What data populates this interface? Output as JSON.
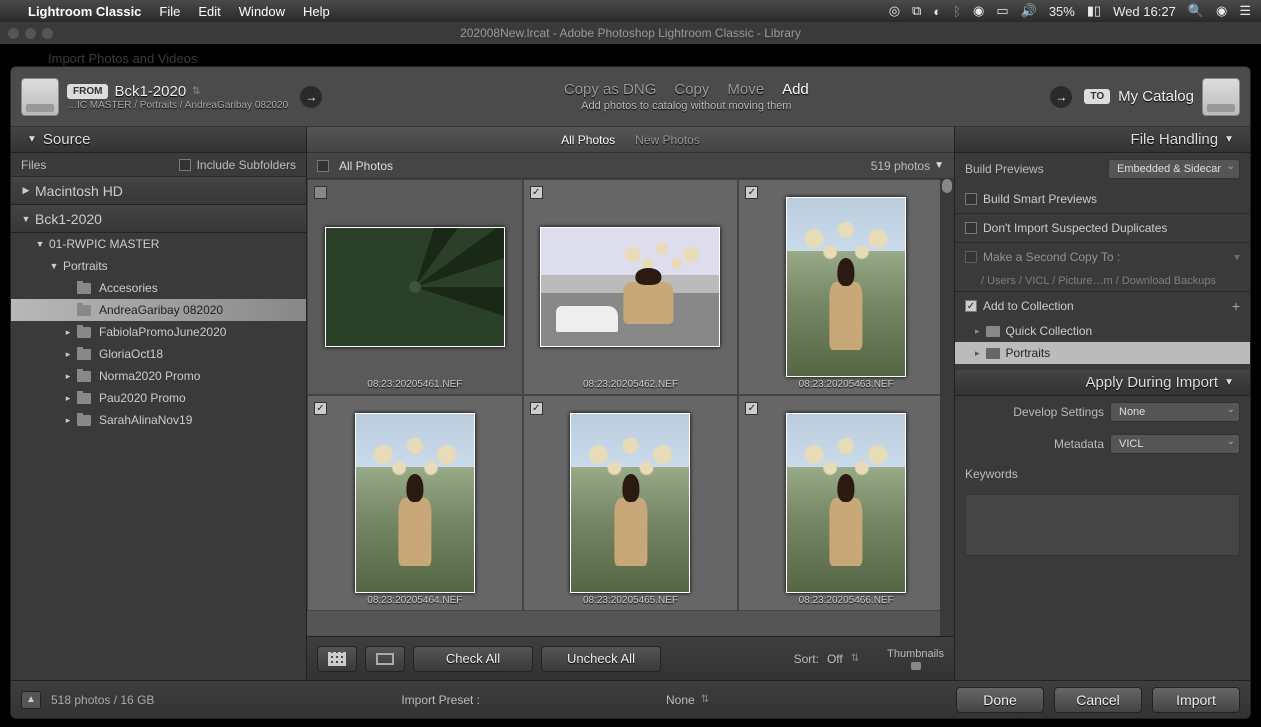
{
  "menubar": {
    "app": "Lightroom Classic",
    "items": [
      "File",
      "Edit",
      "Window",
      "Help"
    ],
    "battery": "35%",
    "clock": "Wed 16:27"
  },
  "window_title": "202008New.lrcat - Adobe Photoshop Lightroom Classic - Library",
  "modal_title": "Import Photos and Videos",
  "header": {
    "from_badge": "FROM",
    "from_volume": "Bck1-2020",
    "from_path": "…IC MASTER / Portraits / AndreaGaribay 082020",
    "copy_tabs": [
      "Copy as DNG",
      "Copy",
      "Move",
      "Add"
    ],
    "copy_active": 3,
    "copy_sub": "Add photos to catalog without moving them",
    "to_badge": "TO",
    "to_label": "My Catalog"
  },
  "left": {
    "section": "Source",
    "files_label": "Files",
    "include_subfolders": "Include Subfolders",
    "volumes": [
      {
        "name": "Macintosh HD",
        "expanded": false
      },
      {
        "name": "Bck1-2020",
        "expanded": true
      }
    ],
    "tree": [
      {
        "level": 1,
        "name": "01-RWPIC MASTER",
        "expanded": true
      },
      {
        "level": 2,
        "name": "Portraits",
        "expanded": true
      },
      {
        "level": 3,
        "name": "Accesories",
        "expanded": false
      },
      {
        "level": 3,
        "name": "AndreaGaribay 082020",
        "selected": true
      },
      {
        "level": 3,
        "name": "FabiolaPromoJune2020",
        "expanded": false
      },
      {
        "level": 3,
        "name": "GloriaOct18",
        "expanded": false
      },
      {
        "level": 3,
        "name": "Norma2020 Promo",
        "expanded": false
      },
      {
        "level": 3,
        "name": "Pau2020 Promo",
        "expanded": false
      },
      {
        "level": 3,
        "name": "SarahAlinaNov19",
        "expanded": false
      }
    ]
  },
  "center": {
    "tabs": [
      "All Photos",
      "New Photos"
    ],
    "tab_active": 0,
    "grid_title": "All Photos",
    "count": "519 photos",
    "thumbs": [
      {
        "file": "08:23:20205461.NEF",
        "checked": false,
        "variant": "dark-land"
      },
      {
        "file": "08:23:20205462.NEF",
        "checked": true,
        "variant": "car-land"
      },
      {
        "file": "08:23:20205463.NEF",
        "checked": true,
        "variant": "grass-port"
      },
      {
        "file": "08:23:20205464.NEF",
        "checked": true,
        "variant": "grass-port"
      },
      {
        "file": "08:23:20205465.NEF",
        "checked": true,
        "variant": "grass-port"
      },
      {
        "file": "08:23:20205466.NEF",
        "checked": true,
        "variant": "grass-port"
      }
    ],
    "toolbar": {
      "check_all": "Check All",
      "uncheck_all": "Uncheck All",
      "sort_label": "Sort:",
      "sort_value": "Off",
      "thumbnails_label": "Thumbnails"
    }
  },
  "right": {
    "file_handling": "File Handling",
    "build_previews_label": "Build Previews",
    "build_previews_value": "Embedded & Sidecar",
    "build_smart": "Build Smart Previews",
    "dont_import_dup": "Don't Import Suspected Duplicates",
    "second_copy_label": "Make a Second Copy To :",
    "second_copy_path": "/ Users / VICL / Picture…m / Download Backups",
    "add_to_collection": "Add to Collection",
    "collections": [
      {
        "name": "Quick Collection",
        "selected": false
      },
      {
        "name": "Portraits",
        "selected": true
      }
    ],
    "apply_during_import": "Apply During Import",
    "develop_settings_label": "Develop Settings",
    "develop_settings_value": "None",
    "metadata_label": "Metadata",
    "metadata_value": "VICL",
    "keywords_label": "Keywords"
  },
  "footer": {
    "info": "518 photos / 16 GB",
    "import_preset_label": "Import Preset :",
    "import_preset_value": "None",
    "done": "Done",
    "cancel": "Cancel",
    "import": "Import"
  }
}
